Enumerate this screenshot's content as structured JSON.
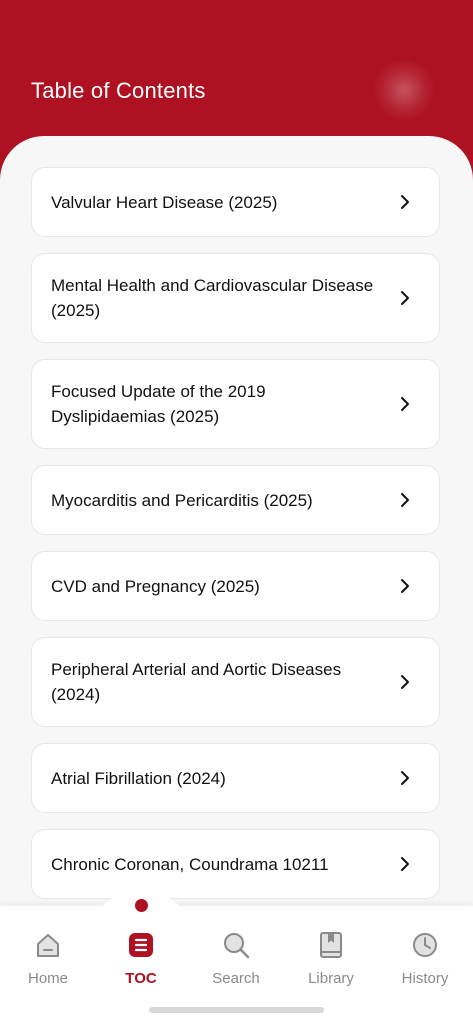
{
  "header": {
    "title": "Table of Contents"
  },
  "toc": {
    "items": [
      {
        "label": "Valvular Heart Disease (2025)"
      },
      {
        "label": "Mental Health and Cardiovascular Disease (2025)"
      },
      {
        "label": "Focused Update of the 2019 Dyslipidaemias (2025)"
      },
      {
        "label": "Myocarditis and Pericarditis (2025)"
      },
      {
        "label": "CVD and Pregnancy (2025)"
      },
      {
        "label": "Peripheral Arterial and Aortic Diseases (2024)"
      },
      {
        "label": "Atrial Fibrillation (2024)"
      },
      {
        "label": "Chronic Coronan, Coundrama 10211"
      }
    ]
  },
  "nav": {
    "home": "Home",
    "toc": "TOC",
    "search": "Search",
    "library": "Library",
    "history": "History"
  },
  "colors": {
    "brand": "#ae1121",
    "inactive": "#8a8a8a",
    "background": "#f7f7f7"
  },
  "icons": {
    "chevron": "chevron-right-icon",
    "home": "home-icon",
    "toc": "list-icon",
    "search": "search-icon",
    "library": "book-icon",
    "history": "clock-icon"
  }
}
